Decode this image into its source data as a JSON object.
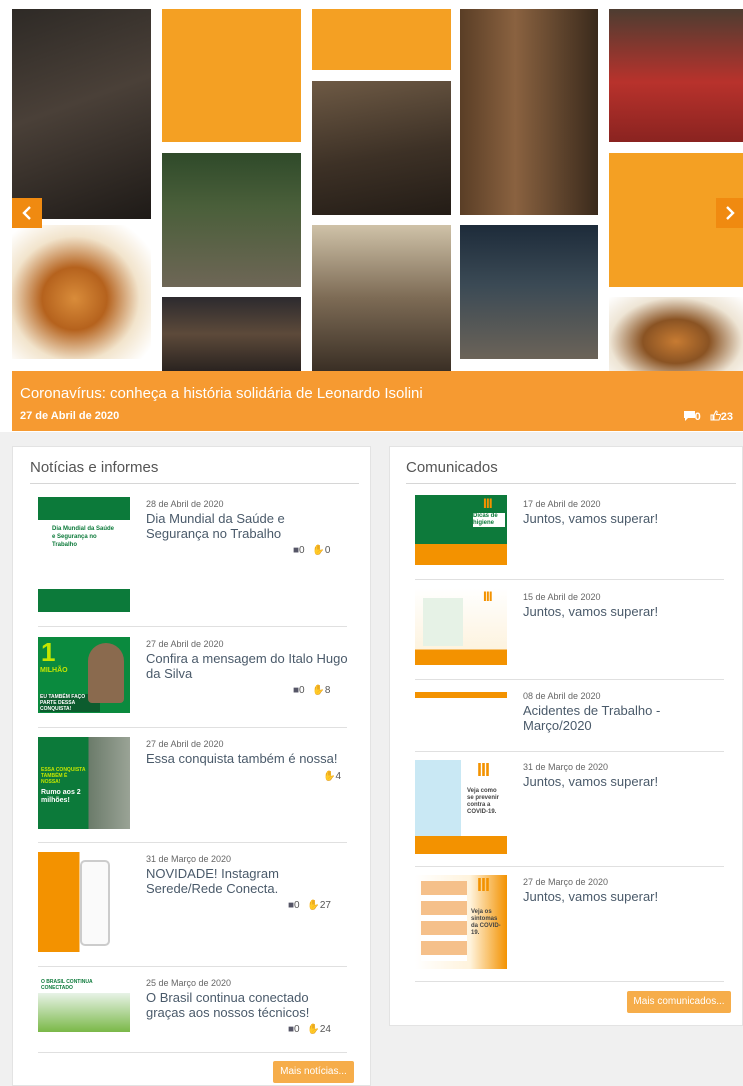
{
  "hero": {
    "title": "Coronavírus: conheça a história solidária de Leonardo Isolini",
    "date": "27 de Abril de 2020",
    "comments": "0",
    "likes": "23",
    "prev_icon": "chevron-left-icon",
    "next_icon": "chevron-right-icon",
    "accent": "#f4a023"
  },
  "noticias": {
    "title": "Notícias e informes",
    "more_label": "Mais notícias...",
    "items": [
      {
        "date": "28 de Abril de 2020",
        "title": "Dia Mundial da Saúde e Segurança no Trabalho",
        "comments": "0",
        "likes": "0"
      },
      {
        "date": "27 de Abril de 2020",
        "title": "Confira a mensagem do Italo Hugo da Silva",
        "comments": "0",
        "likes": "8"
      },
      {
        "date": "27 de Abril de 2020",
        "title": "Essa conquista também é nossa!",
        "likes": "4"
      },
      {
        "date": "31 de Março de 2020",
        "title": "NOVIDADE! Instagram Serede/Rede Conecta.",
        "comments": "0",
        "likes": "27"
      },
      {
        "date": "25 de Março de 2020",
        "title": "O Brasil continua conectado graças aos nossos técnicos!",
        "comments": "0",
        "likes": "24"
      }
    ]
  },
  "comunicados": {
    "title": "Comunicados",
    "more_label": "Mais comunicados...",
    "items": [
      {
        "date": "17 de Abril de 2020",
        "title": "Juntos, vamos superar!"
      },
      {
        "date": "15 de Abril de 2020",
        "title": "Juntos, vamos superar!"
      },
      {
        "date": "08 de Abril de 2020",
        "title": "Acidentes de Trabalho - Março/2020"
      },
      {
        "date": "31 de Março de 2020",
        "title": "Juntos, vamos superar!"
      },
      {
        "date": "27 de Março de 2020",
        "title": "Juntos, vamos superar!"
      }
    ]
  },
  "thumb_text": {
    "n1": "Dia Mundial da Saúde e Segurança no Trabalho",
    "n2_big": "1",
    "n2_label": "MILHÃO",
    "n2_caption": "EU TAMBÉM FAÇO PARTE DESSA CONQUISTA!",
    "n3": "ESSA CONQUISTA TAMBÉM É NOSSA!",
    "n3_sub": "Rumo aos 2 milhões!",
    "n5": "O BRASIL CONTINUA CONECTADO",
    "c1": "Dicas de higiene",
    "c4": "Veja como se prevenir contra a COVID-19.",
    "c5": "Veja os sintomas da COVID-19."
  }
}
